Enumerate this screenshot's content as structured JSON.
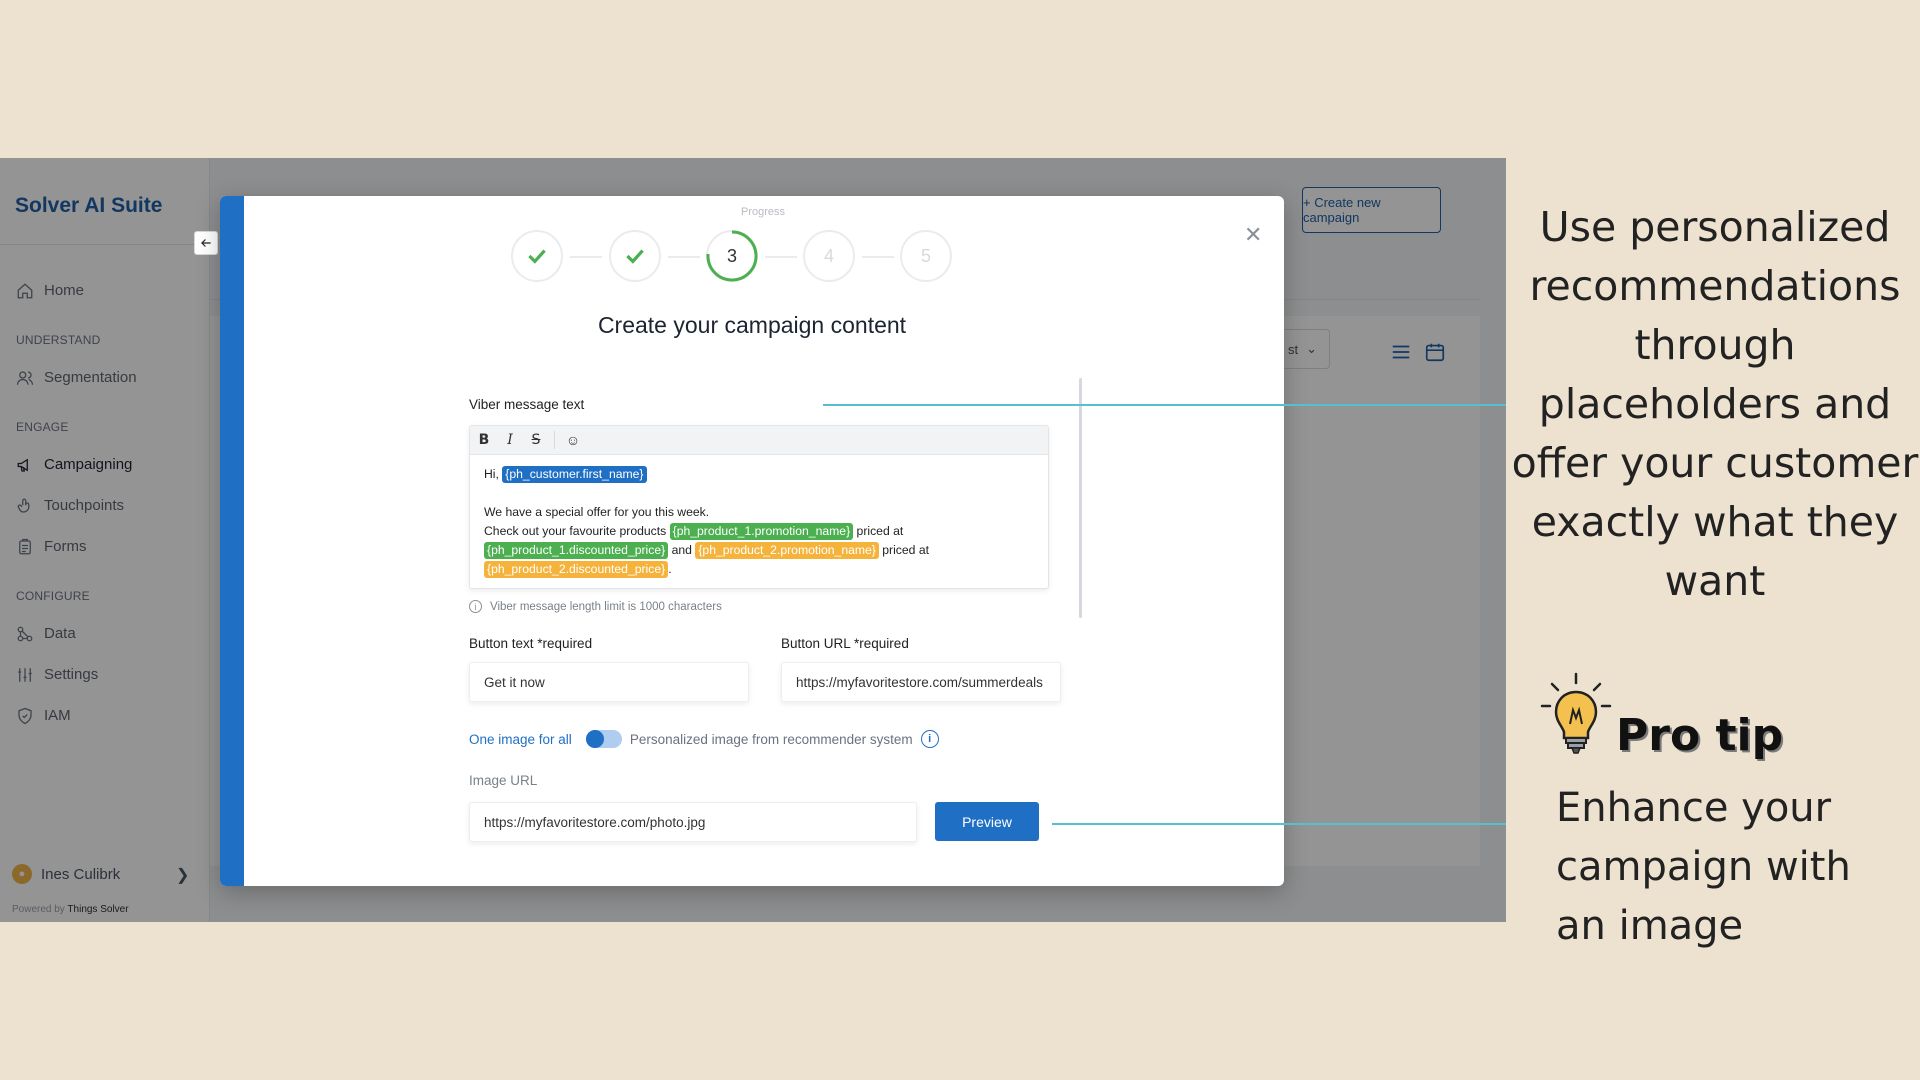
{
  "app": {
    "brand": "Solver AI Suite",
    "nav": {
      "home": "Home",
      "section_understand": "UNDERSTAND",
      "segmentation": "Segmentation",
      "section_engage": "ENGAGE",
      "campaigning": "Campaigning",
      "touchpoints": "Touchpoints",
      "forms": "Forms",
      "section_configure": "CONFIGURE",
      "data": "Data",
      "settings": "Settings",
      "iam": "IAM"
    },
    "user": {
      "name": "Ines Culibrk"
    },
    "powered_by": "Powered by",
    "powered_company": "Things Solver",
    "create_button": "+ Create new campaign",
    "filter_text": "st"
  },
  "modal": {
    "progress_label": "Progress",
    "steps": [
      "1",
      "2",
      "3",
      "4",
      "5"
    ],
    "current_step": 3,
    "title": "Create your campaign content",
    "message_label": "Viber message text",
    "message": {
      "greeting": "Hi,",
      "ph_first_name": "{ph_customer.first_name}",
      "line2": "We have a special offer for you this week.",
      "line3_prefix": "Check out your favourite products",
      "ph_p1_promo": "{ph_product_1.promotion_name}",
      "priced_at_1": "priced at",
      "ph_p1_price": "{ph_product_1.discounted_price}",
      "and": "and",
      "ph_p2_promo": "{ph_product_2.promotion_name}",
      "priced_at_2": "priced at",
      "ph_p2_price": "{ph_product_2.discounted_price}",
      "period": "."
    },
    "message_hint": "Viber message length limit is 1000 characters",
    "button_text_label": "Button text *required",
    "button_text_value": "Get it now",
    "button_url_label": "Button URL *required",
    "button_url_value": "https://myfavoritestore.com/summerdeals",
    "toggle_left": "One image for all",
    "toggle_right": "Personalized image from recommender system",
    "image_url_label": "Image URL",
    "image_url_value": "https://myfavoritestore.com/photo.jpg",
    "preview_button": "Preview"
  },
  "caption": {
    "main": "Use personalized recommendations through placeholders and offer your customer exactly what they want",
    "pro_tip_title": "Pro tip",
    "pro_tip_text": "Enhance your campaign with an image"
  },
  "colors": {
    "brand": "#1f5fa8",
    "accent": "#1f6fc5",
    "green_placeholder": "#4caf50",
    "orange_placeholder": "#f5b33c",
    "callout_line": "#57c0cf",
    "background": "#ede2d0"
  }
}
